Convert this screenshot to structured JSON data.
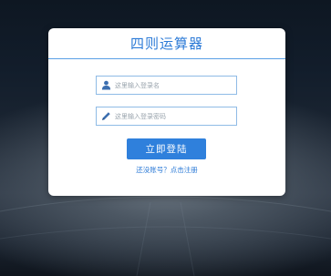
{
  "card": {
    "title": "四则运算器"
  },
  "username": {
    "placeholder": "这里输入登录名",
    "icon": "user-icon"
  },
  "password": {
    "placeholder": "这里输入登录密码",
    "icon": "pencil-icon"
  },
  "actions": {
    "login_label": "立即登陆",
    "register_link": "还没账号？点击注册"
  },
  "colors": {
    "accent": "#2f80dc",
    "title": "#2d7bd7",
    "field_border": "#8fbbe6"
  }
}
